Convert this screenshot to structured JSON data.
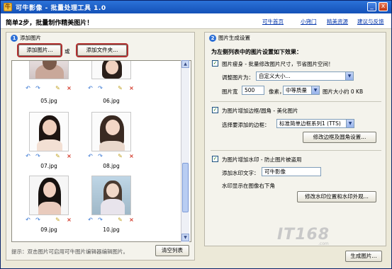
{
  "window": {
    "title": "可牛影像 - 批量处理工具 1.0",
    "min_glyph": "_",
    "close_glyph": "x"
  },
  "header": {
    "slogan": "简单2步，批量制作精美图片！",
    "links": [
      "可牛首页",
      "小窍门",
      "精美资源",
      "建议与反馈"
    ]
  },
  "left_panel": {
    "step": "1",
    "title": "添加图片",
    "add_image_button": "添加图片...",
    "or_text": "或",
    "add_folder_button": "添加文件夹...",
    "hint": "提示：双击图片可启用可牛图片编辑器编辑图片。",
    "clear_button": "清空列表",
    "files": [
      {
        "name": "05.jpg"
      },
      {
        "name": "06.jpg"
      },
      {
        "name": "07.jpg"
      },
      {
        "name": "08.jpg"
      },
      {
        "name": "09.jpg"
      },
      {
        "name": "10.jpg"
      }
    ]
  },
  "right_panel": {
    "step": "2",
    "title": "图片生成设置",
    "heading": "为左侧列表中的图片设置如下效果：",
    "resize": {
      "label": "图片瘦身 - 批量修改图片尺寸，节省图片空间！",
      "adjust_label": "调整图片为：",
      "adjust_value": "自定义大小...",
      "width_label": "图片宽",
      "width_value": "500",
      "unit": "像素，",
      "quality_value": "中等质量",
      "size_text": "图片大小约 0 KB"
    },
    "border": {
      "label": "为图片增加边框/圆角 - 美化图片",
      "select_label": "选择要添加的边框：",
      "select_value": "标准简单边框系列1 (TTS)",
      "button": "修改边框及圆角设置..."
    },
    "watermark": {
      "label": "为图片增加水印 - 防止图片被盗用",
      "text_label": "添加水印文字：",
      "text_value": "可牛影像",
      "position_text": "水印显示在图像右下角",
      "button": "修改水印位置和水印外观..."
    },
    "generate_button": "生成图片..."
  },
  "watermark_overlay": {
    "text": "IT168",
    "sub": ".com"
  },
  "colors": {
    "titlebar": "#1f5fc8",
    "link": "#0033aa",
    "highlight": "#b03030"
  }
}
